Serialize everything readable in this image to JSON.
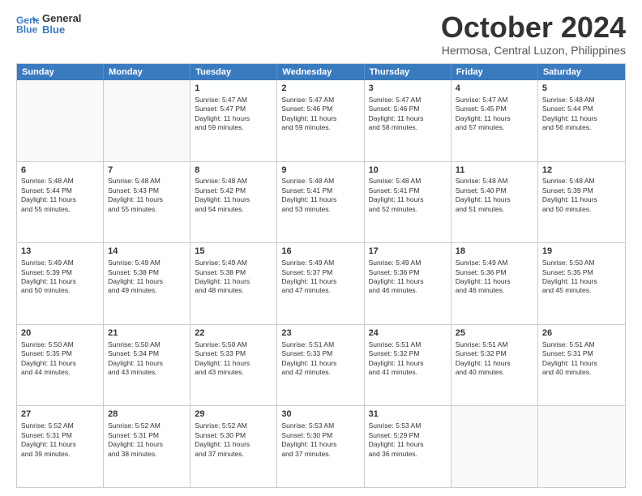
{
  "header": {
    "logo_line1": "General",
    "logo_line2": "Blue",
    "month": "October 2024",
    "location": "Hermosa, Central Luzon, Philippines"
  },
  "weekdays": [
    "Sunday",
    "Monday",
    "Tuesday",
    "Wednesday",
    "Thursday",
    "Friday",
    "Saturday"
  ],
  "rows": [
    [
      {
        "day": "",
        "info": "",
        "empty": true
      },
      {
        "day": "",
        "info": "",
        "empty": true
      },
      {
        "day": "1",
        "info": "Sunrise: 5:47 AM\nSunset: 5:47 PM\nDaylight: 11 hours\nand 59 minutes."
      },
      {
        "day": "2",
        "info": "Sunrise: 5:47 AM\nSunset: 5:46 PM\nDaylight: 11 hours\nand 59 minutes."
      },
      {
        "day": "3",
        "info": "Sunrise: 5:47 AM\nSunset: 5:46 PM\nDaylight: 11 hours\nand 58 minutes."
      },
      {
        "day": "4",
        "info": "Sunrise: 5:47 AM\nSunset: 5:45 PM\nDaylight: 11 hours\nand 57 minutes."
      },
      {
        "day": "5",
        "info": "Sunrise: 5:48 AM\nSunset: 5:44 PM\nDaylight: 11 hours\nand 56 minutes."
      }
    ],
    [
      {
        "day": "6",
        "info": "Sunrise: 5:48 AM\nSunset: 5:44 PM\nDaylight: 11 hours\nand 55 minutes."
      },
      {
        "day": "7",
        "info": "Sunrise: 5:48 AM\nSunset: 5:43 PM\nDaylight: 11 hours\nand 55 minutes."
      },
      {
        "day": "8",
        "info": "Sunrise: 5:48 AM\nSunset: 5:42 PM\nDaylight: 11 hours\nand 54 minutes."
      },
      {
        "day": "9",
        "info": "Sunrise: 5:48 AM\nSunset: 5:41 PM\nDaylight: 11 hours\nand 53 minutes."
      },
      {
        "day": "10",
        "info": "Sunrise: 5:48 AM\nSunset: 5:41 PM\nDaylight: 11 hours\nand 52 minutes."
      },
      {
        "day": "11",
        "info": "Sunrise: 5:48 AM\nSunset: 5:40 PM\nDaylight: 11 hours\nand 51 minutes."
      },
      {
        "day": "12",
        "info": "Sunrise: 5:48 AM\nSunset: 5:39 PM\nDaylight: 11 hours\nand 50 minutes."
      }
    ],
    [
      {
        "day": "13",
        "info": "Sunrise: 5:49 AM\nSunset: 5:39 PM\nDaylight: 11 hours\nand 50 minutes."
      },
      {
        "day": "14",
        "info": "Sunrise: 5:49 AM\nSunset: 5:38 PM\nDaylight: 11 hours\nand 49 minutes."
      },
      {
        "day": "15",
        "info": "Sunrise: 5:49 AM\nSunset: 5:38 PM\nDaylight: 11 hours\nand 48 minutes."
      },
      {
        "day": "16",
        "info": "Sunrise: 5:49 AM\nSunset: 5:37 PM\nDaylight: 11 hours\nand 47 minutes."
      },
      {
        "day": "17",
        "info": "Sunrise: 5:49 AM\nSunset: 5:36 PM\nDaylight: 11 hours\nand 46 minutes."
      },
      {
        "day": "18",
        "info": "Sunrise: 5:49 AM\nSunset: 5:36 PM\nDaylight: 11 hours\nand 46 minutes."
      },
      {
        "day": "19",
        "info": "Sunrise: 5:50 AM\nSunset: 5:35 PM\nDaylight: 11 hours\nand 45 minutes."
      }
    ],
    [
      {
        "day": "20",
        "info": "Sunrise: 5:50 AM\nSunset: 5:35 PM\nDaylight: 11 hours\nand 44 minutes."
      },
      {
        "day": "21",
        "info": "Sunrise: 5:50 AM\nSunset: 5:34 PM\nDaylight: 11 hours\nand 43 minutes."
      },
      {
        "day": "22",
        "info": "Sunrise: 5:50 AM\nSunset: 5:33 PM\nDaylight: 11 hours\nand 43 minutes."
      },
      {
        "day": "23",
        "info": "Sunrise: 5:51 AM\nSunset: 5:33 PM\nDaylight: 11 hours\nand 42 minutes."
      },
      {
        "day": "24",
        "info": "Sunrise: 5:51 AM\nSunset: 5:32 PM\nDaylight: 11 hours\nand 41 minutes."
      },
      {
        "day": "25",
        "info": "Sunrise: 5:51 AM\nSunset: 5:32 PM\nDaylight: 11 hours\nand 40 minutes."
      },
      {
        "day": "26",
        "info": "Sunrise: 5:51 AM\nSunset: 5:31 PM\nDaylight: 11 hours\nand 40 minutes."
      }
    ],
    [
      {
        "day": "27",
        "info": "Sunrise: 5:52 AM\nSunset: 5:31 PM\nDaylight: 11 hours\nand 39 minutes."
      },
      {
        "day": "28",
        "info": "Sunrise: 5:52 AM\nSunset: 5:31 PM\nDaylight: 11 hours\nand 38 minutes."
      },
      {
        "day": "29",
        "info": "Sunrise: 5:52 AM\nSunset: 5:30 PM\nDaylight: 11 hours\nand 37 minutes."
      },
      {
        "day": "30",
        "info": "Sunrise: 5:53 AM\nSunset: 5:30 PM\nDaylight: 11 hours\nand 37 minutes."
      },
      {
        "day": "31",
        "info": "Sunrise: 5:53 AM\nSunset: 5:29 PM\nDaylight: 11 hours\nand 36 minutes."
      },
      {
        "day": "",
        "info": "",
        "empty": true
      },
      {
        "day": "",
        "info": "",
        "empty": true
      }
    ]
  ]
}
